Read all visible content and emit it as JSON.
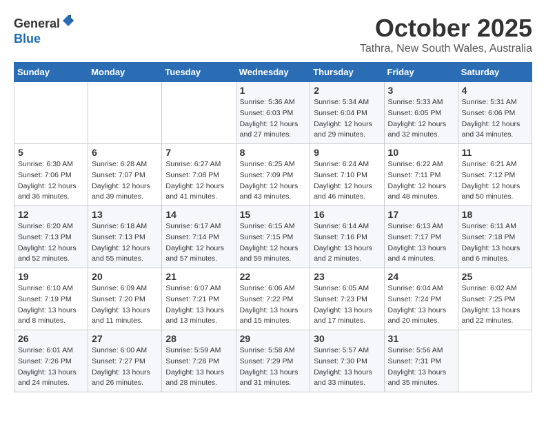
{
  "logo": {
    "general": "General",
    "blue": "Blue"
  },
  "header": {
    "title": "October 2025",
    "subtitle": "Tathra, New South Wales, Australia"
  },
  "weekdays": [
    "Sunday",
    "Monday",
    "Tuesday",
    "Wednesday",
    "Thursday",
    "Friday",
    "Saturday"
  ],
  "weeks": [
    [
      {
        "day": "",
        "info": ""
      },
      {
        "day": "",
        "info": ""
      },
      {
        "day": "",
        "info": ""
      },
      {
        "day": "1",
        "info": "Sunrise: 5:36 AM\nSunset: 6:03 PM\nDaylight: 12 hours\nand 27 minutes."
      },
      {
        "day": "2",
        "info": "Sunrise: 5:34 AM\nSunset: 6:04 PM\nDaylight: 12 hours\nand 29 minutes."
      },
      {
        "day": "3",
        "info": "Sunrise: 5:33 AM\nSunset: 6:05 PM\nDaylight: 12 hours\nand 32 minutes."
      },
      {
        "day": "4",
        "info": "Sunrise: 5:31 AM\nSunset: 6:06 PM\nDaylight: 12 hours\nand 34 minutes."
      }
    ],
    [
      {
        "day": "5",
        "info": "Sunrise: 6:30 AM\nSunset: 7:06 PM\nDaylight: 12 hours\nand 36 minutes."
      },
      {
        "day": "6",
        "info": "Sunrise: 6:28 AM\nSunset: 7:07 PM\nDaylight: 12 hours\nand 39 minutes."
      },
      {
        "day": "7",
        "info": "Sunrise: 6:27 AM\nSunset: 7:08 PM\nDaylight: 12 hours\nand 41 minutes."
      },
      {
        "day": "8",
        "info": "Sunrise: 6:25 AM\nSunset: 7:09 PM\nDaylight: 12 hours\nand 43 minutes."
      },
      {
        "day": "9",
        "info": "Sunrise: 6:24 AM\nSunset: 7:10 PM\nDaylight: 12 hours\nand 46 minutes."
      },
      {
        "day": "10",
        "info": "Sunrise: 6:22 AM\nSunset: 7:11 PM\nDaylight: 12 hours\nand 48 minutes."
      },
      {
        "day": "11",
        "info": "Sunrise: 6:21 AM\nSunset: 7:12 PM\nDaylight: 12 hours\nand 50 minutes."
      }
    ],
    [
      {
        "day": "12",
        "info": "Sunrise: 6:20 AM\nSunset: 7:13 PM\nDaylight: 12 hours\nand 52 minutes."
      },
      {
        "day": "13",
        "info": "Sunrise: 6:18 AM\nSunset: 7:13 PM\nDaylight: 12 hours\nand 55 minutes."
      },
      {
        "day": "14",
        "info": "Sunrise: 6:17 AM\nSunset: 7:14 PM\nDaylight: 12 hours\nand 57 minutes."
      },
      {
        "day": "15",
        "info": "Sunrise: 6:15 AM\nSunset: 7:15 PM\nDaylight: 12 hours\nand 59 minutes."
      },
      {
        "day": "16",
        "info": "Sunrise: 6:14 AM\nSunset: 7:16 PM\nDaylight: 13 hours\nand 2 minutes."
      },
      {
        "day": "17",
        "info": "Sunrise: 6:13 AM\nSunset: 7:17 PM\nDaylight: 13 hours\nand 4 minutes."
      },
      {
        "day": "18",
        "info": "Sunrise: 6:11 AM\nSunset: 7:18 PM\nDaylight: 13 hours\nand 6 minutes."
      }
    ],
    [
      {
        "day": "19",
        "info": "Sunrise: 6:10 AM\nSunset: 7:19 PM\nDaylight: 13 hours\nand 8 minutes."
      },
      {
        "day": "20",
        "info": "Sunrise: 6:09 AM\nSunset: 7:20 PM\nDaylight: 13 hours\nand 11 minutes."
      },
      {
        "day": "21",
        "info": "Sunrise: 6:07 AM\nSunset: 7:21 PM\nDaylight: 13 hours\nand 13 minutes."
      },
      {
        "day": "22",
        "info": "Sunrise: 6:06 AM\nSunset: 7:22 PM\nDaylight: 13 hours\nand 15 minutes."
      },
      {
        "day": "23",
        "info": "Sunrise: 6:05 AM\nSunset: 7:23 PM\nDaylight: 13 hours\nand 17 minutes."
      },
      {
        "day": "24",
        "info": "Sunrise: 6:04 AM\nSunset: 7:24 PM\nDaylight: 13 hours\nand 20 minutes."
      },
      {
        "day": "25",
        "info": "Sunrise: 6:02 AM\nSunset: 7:25 PM\nDaylight: 13 hours\nand 22 minutes."
      }
    ],
    [
      {
        "day": "26",
        "info": "Sunrise: 6:01 AM\nSunset: 7:26 PM\nDaylight: 13 hours\nand 24 minutes."
      },
      {
        "day": "27",
        "info": "Sunrise: 6:00 AM\nSunset: 7:27 PM\nDaylight: 13 hours\nand 26 minutes."
      },
      {
        "day": "28",
        "info": "Sunrise: 5:59 AM\nSunset: 7:28 PM\nDaylight: 13 hours\nand 28 minutes."
      },
      {
        "day": "29",
        "info": "Sunrise: 5:58 AM\nSunset: 7:29 PM\nDaylight: 13 hours\nand 31 minutes."
      },
      {
        "day": "30",
        "info": "Sunrise: 5:57 AM\nSunset: 7:30 PM\nDaylight: 13 hours\nand 33 minutes."
      },
      {
        "day": "31",
        "info": "Sunrise: 5:56 AM\nSunset: 7:31 PM\nDaylight: 13 hours\nand 35 minutes."
      },
      {
        "day": "",
        "info": ""
      }
    ]
  ]
}
